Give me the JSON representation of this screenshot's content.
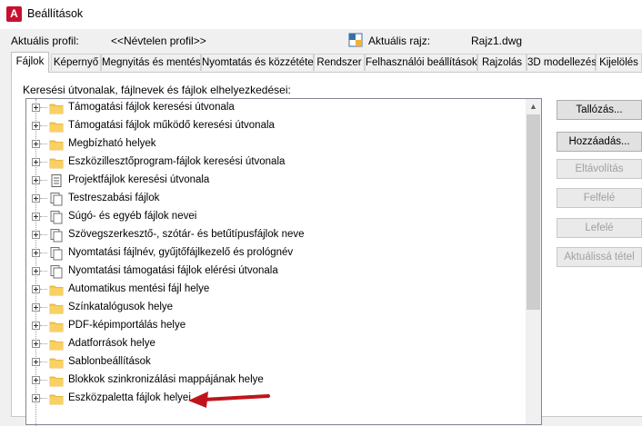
{
  "window": {
    "title": "Beállítások",
    "app_icon_letter": "A"
  },
  "profile": {
    "label": "Aktuális profil:",
    "value": "<<Névtelen profil>>",
    "drawing_label": "Aktuális rajz:",
    "drawing_value": "Rajz1.dwg"
  },
  "tabs": [
    {
      "label": "Fájlok",
      "active": true
    },
    {
      "label": "Képernyő"
    },
    {
      "label": "Megnyitás és mentés"
    },
    {
      "label": "Nyomtatás és közzététel"
    },
    {
      "label": "Rendszer"
    },
    {
      "label": "Felhasználói beállítások"
    },
    {
      "label": "Rajzolás"
    },
    {
      "label": "3D modellezés"
    },
    {
      "label": "Kijelölés"
    }
  ],
  "panel": {
    "caption": "Keresési útvonalak, fájlnevek és fájlok elhelyezkedései:"
  },
  "tree_items": [
    {
      "label": "Támogatási fájlok keresési útvonala",
      "icon": "folder-icon"
    },
    {
      "label": "Támogatási fájlok működő keresési útvonala",
      "icon": "folder-icon"
    },
    {
      "label": "Megbízható helyek",
      "icon": "folder-icon"
    },
    {
      "label": "Eszközillesztőprogram-fájlok keresési útvonala",
      "icon": "folder-icon"
    },
    {
      "label": "Projektfájlok keresési útvonala",
      "icon": "document-icon"
    },
    {
      "label": "Testreszabási fájlok",
      "icon": "files-icon"
    },
    {
      "label": "Súgó- és egyéb fájlok nevei",
      "icon": "files-icon"
    },
    {
      "label": "Szövegszerkesztő-, szótár- és betűtípusfájlok neve",
      "icon": "files-icon"
    },
    {
      "label": "Nyomtatási fájlnév, gyűjtőfájlkezelő és prológnév",
      "icon": "files-icon"
    },
    {
      "label": "Nyomtatási támogatási fájlok elérési útvonala",
      "icon": "files-icon"
    },
    {
      "label": "Automatikus mentési fájl helye",
      "icon": "folder-icon"
    },
    {
      "label": "Színkatalógusok helye",
      "icon": "folder-icon"
    },
    {
      "label": "PDF-képimportálás helye",
      "icon": "folder-icon"
    },
    {
      "label": "Adatforrások helye",
      "icon": "folder-icon"
    },
    {
      "label": "Sablonbeállítások",
      "icon": "folder-icon"
    },
    {
      "label": "Blokkok szinkronizálási mappájának helye",
      "icon": "folder-icon"
    },
    {
      "label": "Eszközpaletta fájlok helyei",
      "icon": "folder-icon"
    }
  ],
  "buttons": [
    {
      "label": "Tallózás...",
      "enabled": true
    },
    {
      "label": "Hozzáadás...",
      "enabled": true
    },
    {
      "label": "Eltávolítás",
      "enabled": false
    },
    {
      "label": "Felfelé",
      "enabled": false
    },
    {
      "label": "Lefelé",
      "enabled": false
    },
    {
      "label": "Aktuálissá tétel",
      "enabled": false
    }
  ],
  "colors": {
    "folder": "#f7c948",
    "folder_dark": "#e0a82e",
    "arrow": "#c0141c",
    "app_icon": "#c8102e"
  }
}
